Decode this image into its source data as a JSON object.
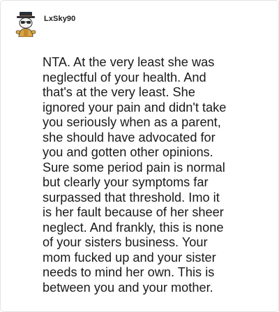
{
  "post": {
    "username": "LxSky90",
    "avatar_icon": "snoo-avatar-with-hat-icon",
    "comment_lines": [
      "NTA. At the very least she was",
      "neglectful of your health. And",
      "that's at the very least. She",
      "ignored your pain and didn't take",
      "you seriously when as a parent,",
      "she should have advocated for",
      "you and gotten other opinions.",
      "Sure some period pain is normal",
      "but clearly your symptoms far",
      "surpassed that threshold. Imo it",
      "is her fault because of her sheer",
      "neglect. And frankly, this is none",
      "of your sisters business. Your",
      "mom fucked up and your sister",
      "needs to mind her own. This is",
      "between you and your mother."
    ]
  },
  "colors": {
    "text": "#1a1a1b",
    "border": "#e4e4e4",
    "background": "#ffffff"
  }
}
